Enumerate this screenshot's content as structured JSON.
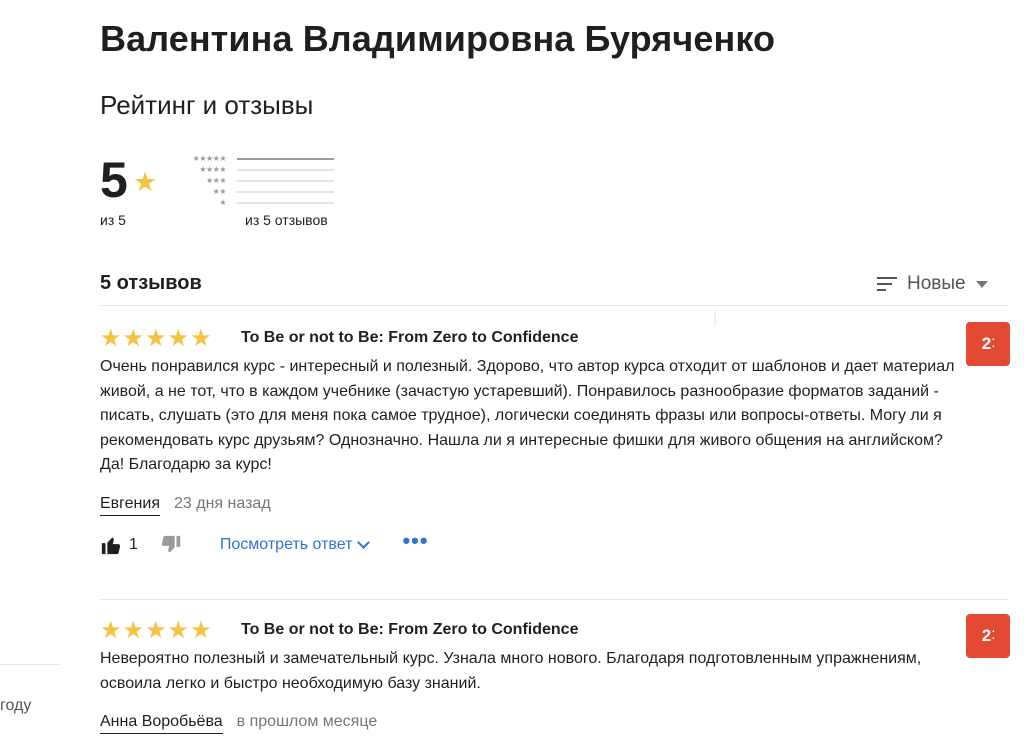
{
  "teacher": {
    "name": "Валентина Владимировна Буряченко"
  },
  "rating_section": {
    "title": "Рейтинг и отзывы",
    "score": "5",
    "star": "★",
    "score_caption": "из 5",
    "distribution": [
      {
        "stars": "★★★★★",
        "fraction": 1.0
      },
      {
        "stars": "★★★★",
        "fraction": 0
      },
      {
        "stars": "★★★",
        "fraction": 0
      },
      {
        "stars": "★★",
        "fraction": 0
      },
      {
        "stars": "★",
        "fraction": 0
      }
    ],
    "distribution_caption": "из 5 отзывов"
  },
  "reviews_header": {
    "count_label": "5 отзывов",
    "sort_label": "Новые",
    "sort_icon": "sort-lines-icon"
  },
  "reviews": [
    {
      "stars": "★★★★★",
      "rating": 5,
      "course": "To Be or not to Be: From Zero to Confidence",
      "badge_num": "2",
      "text": "Очень понравился курс - интересный и полезный. Здорово, что автор курса отходит от шаблонов и дает материал живой, а не тот, что в каждом учебнике (зачастую устаревший). Понравилось разнообразие форматов заданий - писать, слушать (это для меня пока самое трудное), логически соединять фразы или вопросы-ответы. Могу ли я рекомендовать курс друзьям? Однозначно. Нашла ли я интересные фишки для живого общения на английском? Да! Благодарю за курс!",
      "author": "Евгения",
      "date": "23 дня назад",
      "likes": "1",
      "view_reply": "Посмотреть ответ",
      "more": "•••"
    },
    {
      "stars": "★★★★★",
      "rating": 5,
      "course": "To Be or not to Be: From Zero to Confidence",
      "badge_num": "2",
      "text": "Невероятно полезный и замечательный курс. Узнала много нового. Благодаря подготовленным упражнениям, освоила легко и быстро необходимую базу знаний.",
      "author": "Анна Воробьёва",
      "date": "в прошлом месяце"
    }
  ],
  "left_fragment": "году",
  "colors": {
    "star": "#f5c242",
    "link": "#2d73d8",
    "badge": "#e24a34"
  }
}
